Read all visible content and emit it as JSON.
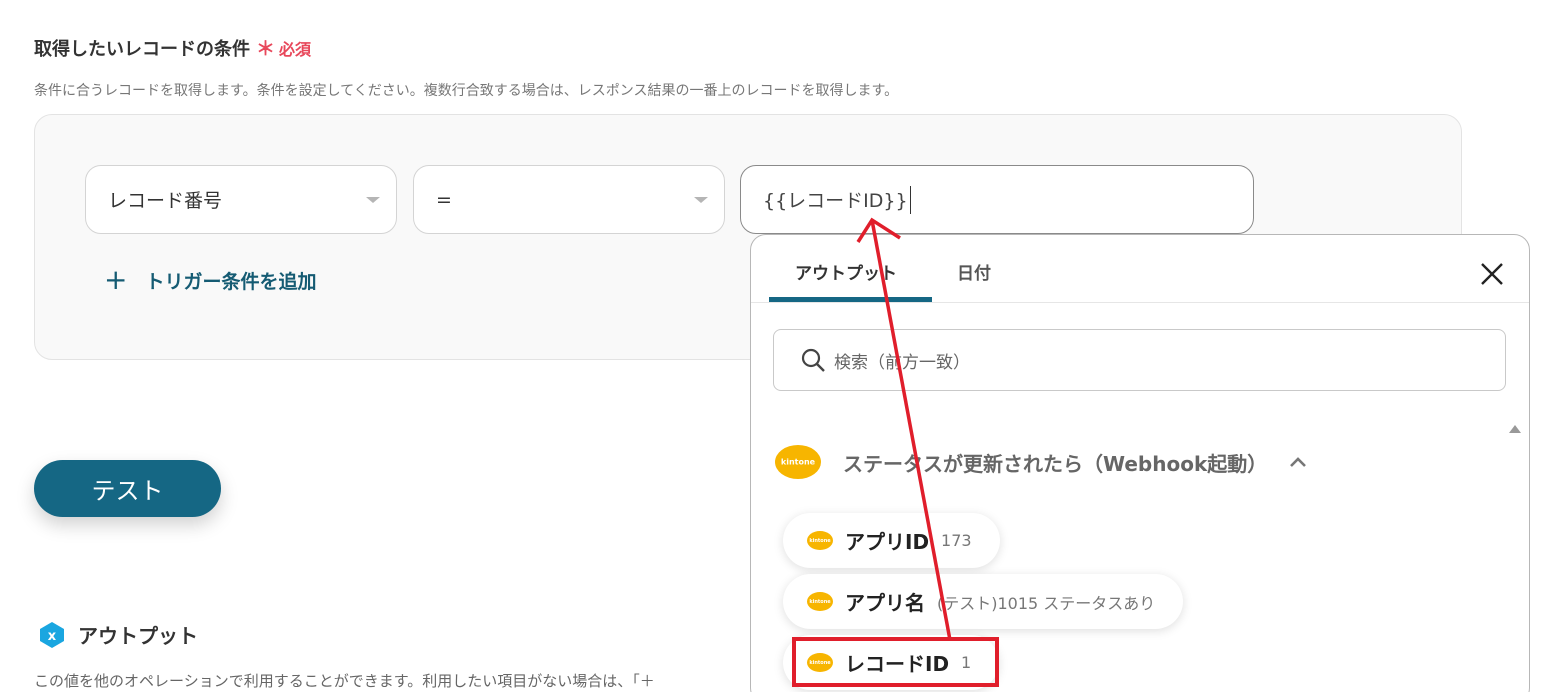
{
  "section": {
    "title": "取得したいレコードの条件",
    "required_mark": "＊",
    "required_text": "必須",
    "description": "条件に合うレコードを取得します。条件を設定してください。複数行合致する場合は、レスポンス結果の一番上のレコードを取得します。"
  },
  "condition": {
    "field_select": "レコード番号",
    "operator_select": "=",
    "value_input": "{{レコードID}}"
  },
  "add_trigger_label": "トリガー条件を追加",
  "test_button_label": "テスト",
  "output": {
    "heading": "アウトプット",
    "description": "この値を他のオペレーションで利用することができます。利用したい項目がない場合は、「＋"
  },
  "panel": {
    "tabs": [
      "アウトプット",
      "日付"
    ],
    "active_tab": "アウトプット",
    "search_placeholder": "検索（前方一致）",
    "group_title": "ステータスが更新されたら（Webhook起動）",
    "logo_text": "kintone",
    "items": [
      {
        "label": "アプリID",
        "value": "173"
      },
      {
        "label": "アプリ名",
        "value": "(テスト)1015 ステータスあり"
      },
      {
        "label": "レコードID",
        "value": "1"
      }
    ]
  },
  "colors": {
    "accent": "#156784",
    "required": "#e8485b",
    "highlight": "#e01e2b",
    "kintone": "#f7b500"
  },
  "icons": [
    "caret-down-icon",
    "plus-icon",
    "close-icon",
    "search-icon",
    "chevron-up-icon",
    "kintone-logo",
    "output-badge-icon",
    "arrow-annotation"
  ]
}
